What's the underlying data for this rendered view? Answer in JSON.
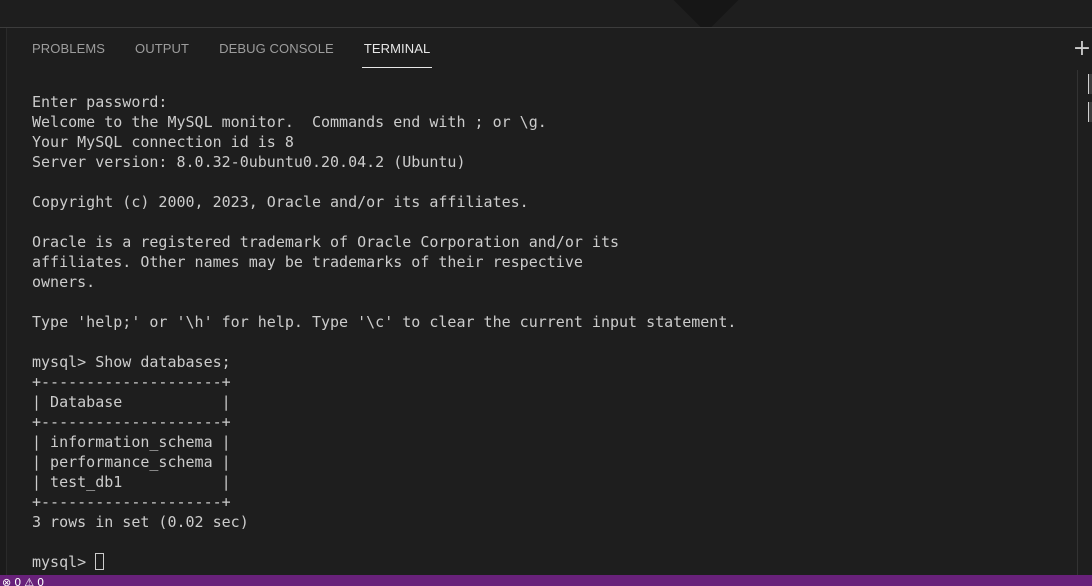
{
  "panel": {
    "tabs": [
      {
        "label": "PROBLEMS"
      },
      {
        "label": "OUTPUT"
      },
      {
        "label": "DEBUG CONSOLE"
      },
      {
        "label": "TERMINAL"
      }
    ],
    "active_tab": "TERMINAL",
    "new_terminal_glyph": "+"
  },
  "terminal": {
    "lines": [
      "Enter password:",
      "Welcome to the MySQL monitor.  Commands end with ; or \\g.",
      "Your MySQL connection id is 8",
      "Server version: 8.0.32-0ubuntu0.20.04.2 (Ubuntu)",
      "",
      "Copyright (c) 2000, 2023, Oracle and/or its affiliates.",
      "",
      "Oracle is a registered trademark of Oracle Corporation and/or its",
      "affiliates. Other names may be trademarks of their respective",
      "owners.",
      "",
      "Type 'help;' or '\\h' for help. Type '\\c' to clear the current input statement.",
      "",
      "mysql> Show databases;",
      "+--------------------+",
      "| Database           |",
      "+--------------------+",
      "| information_schema |",
      "| performance_schema |",
      "| test_db1           |",
      "+--------------------+",
      "3 rows in set (0.02 sec)",
      ""
    ],
    "prompt": "mysql> "
  },
  "statusbar": {
    "errors_icon": "error-circle-icon",
    "errors_count": "0",
    "warnings_icon": "warning-triangle-icon",
    "warnings_count": "0",
    "background": "#68217a"
  },
  "colors": {
    "background": "#1e1e1e",
    "terminal_text": "#cccccc",
    "tab_inactive": "#9d9d9d",
    "tab_active": "#e7e7e7"
  }
}
